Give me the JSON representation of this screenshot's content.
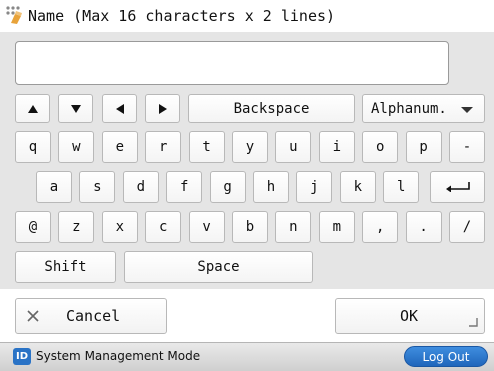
{
  "header": {
    "title": "Name (Max 16 characters x 2 lines)",
    "icon": "name-entry-icon"
  },
  "text_field": {
    "value": ""
  },
  "keyboard": {
    "nav": {
      "up_icon": "up-arrow-icon",
      "down_icon": "down-arrow-icon",
      "left_icon": "left-arrow-icon",
      "right_icon": "right-arrow-icon",
      "backspace_label": "Backspace"
    },
    "mode": {
      "selected": "Alphanum.",
      "icon": "chevron-down-icon"
    },
    "row1": [
      "q",
      "w",
      "e",
      "r",
      "t",
      "y",
      "u",
      "i",
      "o",
      "p",
      "-"
    ],
    "row2": [
      "a",
      "s",
      "d",
      "f",
      "g",
      "h",
      "j",
      "k",
      "l"
    ],
    "enter_icon": "enter-icon",
    "row3": [
      "@",
      "z",
      "x",
      "c",
      "v",
      "b",
      "n",
      "m",
      ",",
      ".",
      "/"
    ],
    "shift_label": "Shift",
    "space_label": "Space"
  },
  "actions": {
    "cancel_label": "Cancel",
    "cancel_icon": "close-icon",
    "ok_label": "OK"
  },
  "status_bar": {
    "id_badge": "ID",
    "mode_text": "System Management Mode",
    "logout_label": "Log Out"
  },
  "colors": {
    "keyboard_bg": "#e5e5e5",
    "accent_blue": "#2a73c6",
    "key_border": "#b8b8b8"
  }
}
